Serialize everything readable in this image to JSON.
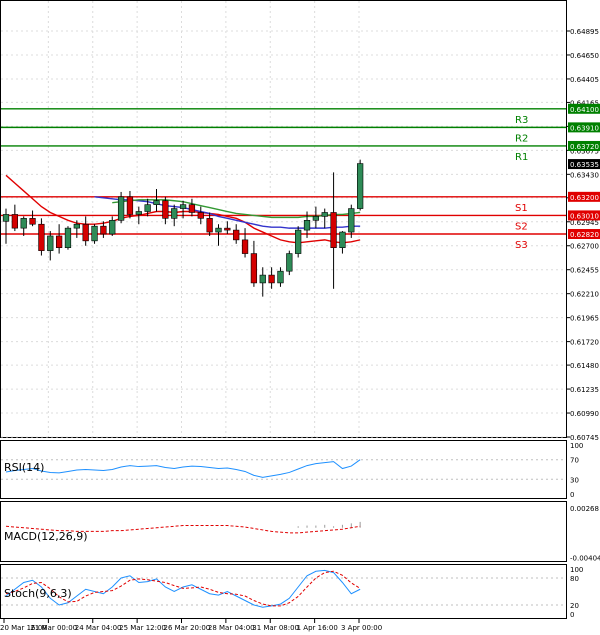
{
  "chart_data": {
    "type": "candlestick",
    "main": {
      "price_range": [
        0.60745,
        0.6512
      ],
      "price_ticks": [
        "0.64895",
        "0.64650",
        "0.64405",
        "0.64165",
        "0.63920",
        "0.63675",
        "0.63430",
        "0.63190",
        "0.62945",
        "0.62700",
        "0.62455",
        "0.62210",
        "0.61965",
        "0.61720",
        "0.61480",
        "0.61235",
        "0.60990",
        "0.60745"
      ],
      "current_price": "0.63535",
      "levels": [
        {
          "name": "R3",
          "value": "0.64100",
          "color": "#008000"
        },
        {
          "name": "R2",
          "value": "0.63910",
          "color": "#008000"
        },
        {
          "name": "R1",
          "value": "0.63720",
          "color": "#008000"
        },
        {
          "name": "S1",
          "value": "0.63200",
          "color": "#e00000"
        },
        {
          "name": "S2",
          "value": "0.63010",
          "color": "#e00000"
        },
        {
          "name": "S3",
          "value": "0.62820",
          "color": "#e00000"
        }
      ],
      "candles": [
        {
          "o": 0.6295,
          "h": 0.6308,
          "l": 0.6272,
          "c": 0.6302
        },
        {
          "o": 0.6302,
          "h": 0.6312,
          "l": 0.6285,
          "c": 0.6288
        },
        {
          "o": 0.6288,
          "h": 0.63,
          "l": 0.628,
          "c": 0.6298
        },
        {
          "o": 0.6298,
          "h": 0.6306,
          "l": 0.629,
          "c": 0.6292
        },
        {
          "o": 0.6292,
          "h": 0.6298,
          "l": 0.626,
          "c": 0.6265
        },
        {
          "o": 0.6265,
          "h": 0.6285,
          "l": 0.6255,
          "c": 0.628
        },
        {
          "o": 0.628,
          "h": 0.6292,
          "l": 0.6262,
          "c": 0.6268
        },
        {
          "o": 0.6268,
          "h": 0.629,
          "l": 0.6266,
          "c": 0.6288
        },
        {
          "o": 0.6288,
          "h": 0.6296,
          "l": 0.6278,
          "c": 0.6292
        },
        {
          "o": 0.6292,
          "h": 0.63,
          "l": 0.627,
          "c": 0.6275
        },
        {
          "o": 0.6275,
          "h": 0.6292,
          "l": 0.6272,
          "c": 0.629
        },
        {
          "o": 0.629,
          "h": 0.6295,
          "l": 0.6278,
          "c": 0.6282
        },
        {
          "o": 0.6282,
          "h": 0.63,
          "l": 0.628,
          "c": 0.6296
        },
        {
          "o": 0.6296,
          "h": 0.6325,
          "l": 0.6293,
          "c": 0.632
        },
        {
          "o": 0.632,
          "h": 0.6326,
          "l": 0.6298,
          "c": 0.6302
        },
        {
          "o": 0.6302,
          "h": 0.631,
          "l": 0.6292,
          "c": 0.6305
        },
        {
          "o": 0.6305,
          "h": 0.6318,
          "l": 0.63,
          "c": 0.6312
        },
        {
          "o": 0.6312,
          "h": 0.6328,
          "l": 0.6305,
          "c": 0.6316
        },
        {
          "o": 0.6316,
          "h": 0.632,
          "l": 0.6292,
          "c": 0.6298
        },
        {
          "o": 0.6298,
          "h": 0.6312,
          "l": 0.629,
          "c": 0.6308
        },
        {
          "o": 0.6308,
          "h": 0.6316,
          "l": 0.6298,
          "c": 0.6312
        },
        {
          "o": 0.6312,
          "h": 0.6318,
          "l": 0.63,
          "c": 0.6304
        },
        {
          "o": 0.6304,
          "h": 0.631,
          "l": 0.6292,
          "c": 0.6298
        },
        {
          "o": 0.6298,
          "h": 0.6304,
          "l": 0.628,
          "c": 0.6284
        },
        {
          "o": 0.6284,
          "h": 0.6292,
          "l": 0.627,
          "c": 0.6288
        },
        {
          "o": 0.6288,
          "h": 0.6295,
          "l": 0.6282,
          "c": 0.6286
        },
        {
          "o": 0.6286,
          "h": 0.6292,
          "l": 0.6272,
          "c": 0.6276
        },
        {
          "o": 0.6276,
          "h": 0.6288,
          "l": 0.6258,
          "c": 0.6262
        },
        {
          "o": 0.6262,
          "h": 0.6275,
          "l": 0.6228,
          "c": 0.6232
        },
        {
          "o": 0.6232,
          "h": 0.6248,
          "l": 0.6218,
          "c": 0.624
        },
        {
          "o": 0.624,
          "h": 0.6248,
          "l": 0.6226,
          "c": 0.6232
        },
        {
          "o": 0.6232,
          "h": 0.6248,
          "l": 0.6228,
          "c": 0.6244
        },
        {
          "o": 0.6244,
          "h": 0.6265,
          "l": 0.624,
          "c": 0.6262
        },
        {
          "o": 0.6262,
          "h": 0.629,
          "l": 0.6258,
          "c": 0.6286
        },
        {
          "o": 0.6286,
          "h": 0.6305,
          "l": 0.6278,
          "c": 0.6296
        },
        {
          "o": 0.6296,
          "h": 0.631,
          "l": 0.6288,
          "c": 0.63
        },
        {
          "o": 0.63,
          "h": 0.6308,
          "l": 0.6288,
          "c": 0.6304
        },
        {
          "o": 0.6304,
          "h": 0.6345,
          "l": 0.6226,
          "c": 0.6268
        },
        {
          "o": 0.6268,
          "h": 0.6285,
          "l": 0.6262,
          "c": 0.6284
        },
        {
          "o": 0.6284,
          "h": 0.6312,
          "l": 0.6278,
          "c": 0.6308
        },
        {
          "o": 0.6308,
          "h": 0.6358,
          "l": 0.6306,
          "c": 0.6354
        }
      ],
      "moving_averages": [
        {
          "color": "#e00000",
          "values": [
            0.6342,
            0.6334,
            0.6326,
            0.6318,
            0.631,
            0.6304,
            0.63,
            0.6296,
            0.6293,
            0.6292,
            0.6292,
            0.6293,
            0.6295,
            0.6298,
            0.63,
            0.6301,
            0.6303,
            0.6305,
            0.6305,
            0.6304,
            0.6305,
            0.6305,
            0.6304,
            0.6303,
            0.6302,
            0.63,
            0.6298,
            0.6294,
            0.6288,
            0.6284,
            0.628,
            0.6276,
            0.6274,
            0.6273,
            0.6274,
            0.6275,
            0.6276,
            0.6274,
            0.6273,
            0.6274,
            0.6276
          ]
        },
        {
          "color": "#3333cc",
          "values": [
            null,
            null,
            null,
            null,
            null,
            null,
            null,
            null,
            null,
            null,
            0.632,
            0.6319,
            0.6318,
            0.6317,
            0.6317,
            0.6316,
            0.6315,
            0.6313,
            0.6311,
            0.631,
            0.6309,
            0.6307,
            0.6305,
            0.6303,
            0.63,
            0.6298,
            0.6296,
            0.6294,
            0.6292,
            0.629,
            0.6289,
            0.6289,
            0.6288,
            0.6288,
            0.6288,
            0.6288,
            0.6288,
            0.6289,
            0.6289,
            0.629,
            0.629
          ]
        },
        {
          "color": "#339933",
          "values": [
            null,
            null,
            null,
            null,
            null,
            null,
            null,
            null,
            null,
            null,
            null,
            null,
            0.6314,
            0.6315,
            0.6316,
            0.6317,
            0.6317,
            0.6317,
            0.6317,
            0.6316,
            0.6315,
            0.6313,
            0.6311,
            0.6309,
            0.6307,
            0.6305,
            0.6303,
            0.6302,
            0.6301,
            0.63,
            0.6299,
            0.6299,
            0.6299,
            0.6299,
            0.63,
            0.63,
            0.6301,
            0.6302,
            0.6302,
            0.6303,
            0.6304
          ]
        }
      ]
    },
    "time_labels": [
      "20 Mar 16:00",
      "21 Mar 00:00",
      "24 Mar 04:00",
      "25 Mar 12:00",
      "26 Mar 20:00",
      "28 Mar 04:00",
      "31 Mar 08:00",
      "1 Apr 16:00",
      "3 Apr 00:00"
    ],
    "rsi": {
      "label": "RSI(14)",
      "ticks": [
        "100",
        "70",
        "30",
        "0"
      ],
      "values": [
        45,
        48,
        50,
        52,
        47,
        44,
        43,
        46,
        49,
        50,
        49,
        48,
        50,
        55,
        58,
        56,
        57,
        58,
        54,
        52,
        55,
        57,
        56,
        54,
        52,
        53,
        50,
        46,
        38,
        34,
        37,
        40,
        44,
        51,
        58,
        62,
        64,
        66,
        52,
        57,
        70
      ]
    },
    "macd": {
      "label": "MACD(12,26,9)",
      "ticks": [
        "0.00268",
        "-0.00404"
      ],
      "signal": [
        0.0002,
        0.0001,
        -0.0,
        -0.0001,
        -0.0002,
        -0.0003,
        -0.0004,
        -0.0004,
        -0.0005,
        -0.0005,
        -0.0005,
        -0.0005,
        -0.0004,
        -0.0004,
        -0.0003,
        -0.0002,
        -0.0001,
        0.0,
        0.0001,
        0.0002,
        0.0003,
        0.0003,
        0.0003,
        0.0003,
        0.0003,
        0.0003,
        0.0002,
        0.0001,
        -0.0001,
        -0.0003,
        -0.0005,
        -0.0006,
        -0.0007,
        -0.0007,
        -0.0006,
        -0.0005,
        -0.0004,
        -0.0003,
        -0.0002,
        0.0,
        0.0002
      ],
      "histogram": [
        0,
        0,
        0,
        0,
        0,
        0,
        0,
        0,
        0,
        0,
        0,
        0,
        0,
        0,
        0,
        0,
        0,
        0,
        0,
        0,
        0,
        0,
        0,
        0,
        0,
        0,
        0,
        0,
        0,
        0,
        0,
        0,
        0,
        0.0002,
        0.0003,
        0.0003,
        0.0004,
        0.0002,
        0.0004,
        0.0006,
        0.0008
      ]
    },
    "stoch": {
      "label": "Stoch(9,6,3)",
      "ticks": [
        "100",
        "80",
        "20",
        "0"
      ],
      "k": [
        40,
        55,
        70,
        75,
        60,
        35,
        20,
        25,
        40,
        55,
        50,
        45,
        60,
        80,
        85,
        70,
        72,
        78,
        60,
        50,
        60,
        65,
        55,
        45,
        42,
        50,
        40,
        30,
        20,
        15,
        18,
        22,
        35,
        60,
        85,
        95,
        97,
        92,
        70,
        45,
        55
      ],
      "d": [
        45,
        50,
        58,
        68,
        70,
        56,
        38,
        27,
        28,
        40,
        48,
        50,
        52,
        62,
        75,
        78,
        76,
        73,
        70,
        63,
        57,
        58,
        60,
        55,
        48,
        45,
        44,
        40,
        30,
        22,
        18,
        18,
        25,
        39,
        60,
        80,
        92,
        95,
        86,
        69,
        57
      ]
    }
  }
}
